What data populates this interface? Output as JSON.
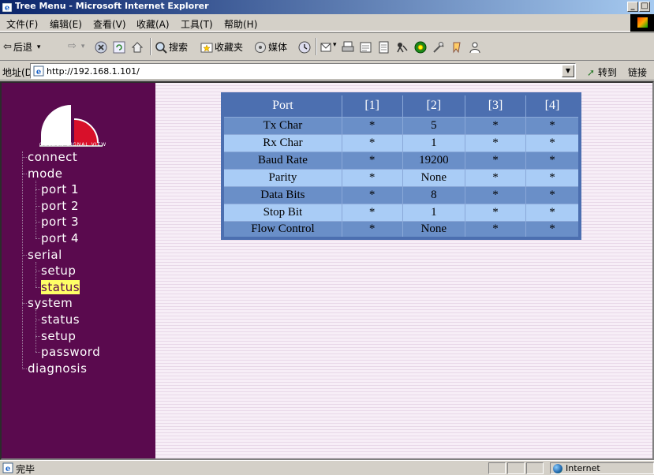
{
  "window": {
    "title": "Tree Menu - Microsoft Internet Explorer",
    "min": "_",
    "max": "□"
  },
  "menu": [
    "文件(F)",
    "编辑(E)",
    "查看(V)",
    "收藏(A)",
    "工具(T)",
    "帮助(H)"
  ],
  "toolbar": {
    "back": "后退",
    "search": "搜索",
    "favorites": "收藏夹",
    "media": "媒体"
  },
  "address": {
    "label": "地址(D)",
    "url": "http://192.168.1.101/",
    "go": "转到",
    "links": "链接"
  },
  "logo_text": "GOLDEN  SIGNAL  VIEW",
  "tree": {
    "items": [
      {
        "label": "connect",
        "level": 0
      },
      {
        "label": "mode",
        "level": 0
      },
      {
        "label": "port 1",
        "level": 1
      },
      {
        "label": "port 2",
        "level": 1
      },
      {
        "label": "port 3",
        "level": 1
      },
      {
        "label": "port 4",
        "level": 1
      },
      {
        "label": "serial",
        "level": 0
      },
      {
        "label": "setup",
        "level": 1
      },
      {
        "label": "status",
        "level": 1,
        "selected": true
      },
      {
        "label": "system",
        "level": 0
      },
      {
        "label": "status",
        "level": 1
      },
      {
        "label": "setup",
        "level": 1
      },
      {
        "label": "password",
        "level": 1
      },
      {
        "label": "diagnosis",
        "level": 0
      }
    ]
  },
  "table": {
    "headers": [
      "Port",
      "[1]",
      "[2]",
      "[3]",
      "[4]"
    ],
    "rows": [
      [
        "Tx Char",
        "*",
        "5",
        "*",
        "*"
      ],
      [
        "Rx Char",
        "*",
        "1",
        "*",
        "*"
      ],
      [
        "Baud Rate",
        "*",
        "19200",
        "*",
        "*"
      ],
      [
        "Parity",
        "*",
        "None",
        "*",
        "*"
      ],
      [
        "Data Bits",
        "*",
        "8",
        "*",
        "*"
      ],
      [
        "Stop Bit",
        "*",
        "1",
        "*",
        "*"
      ],
      [
        "Flow Control",
        "*",
        "None",
        "*",
        "*"
      ]
    ]
  },
  "status": {
    "text": "完毕",
    "zone": "Internet"
  },
  "colors": {
    "sidebar": "#5a0a4e",
    "table_header": "#4c6fb0",
    "row_dark": "#6a8fc8",
    "row_light": "#a9ccf6",
    "highlight": "#ffff66"
  }
}
